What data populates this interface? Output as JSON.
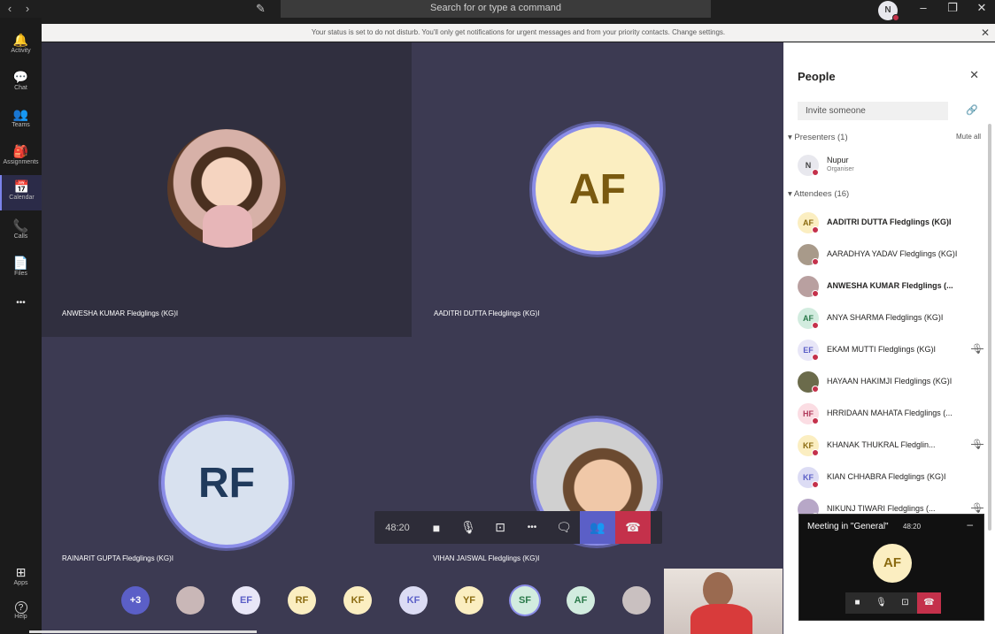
{
  "titlebar": {
    "search_placeholder": "Search for or type a command",
    "user_initial": "N",
    "back_glyph": "‹",
    "forward_glyph": "›",
    "compose_glyph": "✎",
    "minimize_glyph": "–",
    "maximize_glyph": "❐",
    "close_glyph": "✕"
  },
  "notification": {
    "text": "Your status is set to do not disturb. You'll only get notifications for urgent messages and from your priority contacts. Change settings.",
    "close_glyph": "✕"
  },
  "rail": {
    "items": [
      {
        "label": "Activity",
        "icon": "bell-icon",
        "glyph": "🔔"
      },
      {
        "label": "Chat",
        "icon": "chat-icon",
        "glyph": "💬"
      },
      {
        "label": "Teams",
        "icon": "teams-icon",
        "glyph": "👥"
      },
      {
        "label": "Assignments",
        "icon": "assignments-icon",
        "glyph": "🎒"
      },
      {
        "label": "Calendar",
        "icon": "calendar-icon",
        "glyph": "📅"
      },
      {
        "label": "Calls",
        "icon": "phone-icon",
        "glyph": "📞"
      },
      {
        "label": "Files",
        "icon": "file-icon",
        "glyph": "📄"
      },
      {
        "label": "",
        "icon": "more-icon",
        "glyph": "•••"
      }
    ],
    "apps_label": "Apps",
    "help_label": "Help",
    "apps_glyph": "⊞",
    "help_glyph": "?"
  },
  "stage": {
    "tiles": [
      {
        "name": "ANWESHA KUMAR Fledglings (KG)I",
        "initials": "",
        "photo": true
      },
      {
        "name": "AADITRI DUTTA Fledglings (KG)I",
        "initials": "AF",
        "photo": false
      },
      {
        "name": "RAINARIT GUPTA Fledglings (KG)I",
        "initials": "RF",
        "photo": false
      },
      {
        "name": "VIHAN JAISWAL Fledglings (KG)I",
        "initials": "",
        "photo": true
      }
    ],
    "controls": {
      "timer": "48:20",
      "video_glyph": "■",
      "mic_glyph": "🎙",
      "share_glyph": "⊡",
      "more_glyph": "•••",
      "chat_glyph": "🗨",
      "people_glyph": "👥",
      "hangup_glyph": "☎"
    },
    "strip": [
      {
        "label": "+3",
        "bg": "#5b5fc7",
        "fg": "#ffffff"
      },
      {
        "label": "",
        "bg": "#c9b7b7",
        "fg": "#333333"
      },
      {
        "label": "EF",
        "bg": "#e8e6f7",
        "fg": "#5b5fc7"
      },
      {
        "label": "RF",
        "bg": "#fbeec1",
        "fg": "#8a6a10"
      },
      {
        "label": "KF",
        "bg": "#fbeec1",
        "fg": "#8a6a10"
      },
      {
        "label": "KF",
        "bg": "#dcdcf4",
        "fg": "#5b5fc7"
      },
      {
        "label": "YF",
        "bg": "#fbeec1",
        "fg": "#8a6a10"
      },
      {
        "label": "SF",
        "bg": "#d2ecdf",
        "fg": "#2b7a4b"
      },
      {
        "label": "AF",
        "bg": "#d2ecdf",
        "fg": "#2b7a4b"
      },
      {
        "label": "",
        "bg": "#c9c0c0",
        "fg": "#333333"
      }
    ]
  },
  "panel": {
    "title": "People",
    "close_glyph": "✕",
    "invite_placeholder": "Invite someone",
    "share_link_glyph": "🔗",
    "presenters_header": "Presenters (1)",
    "mute_all": "Mute all",
    "presenter": {
      "name": "Nupur",
      "role": "Organiser",
      "initials": "N"
    },
    "attendees_header": "Attendees (16)",
    "attendees": [
      {
        "name": "AADITRI DUTTA Fledglings (KG)I",
        "initials": "AF",
        "bg": "#fbeec1",
        "fg": "#8a6a10",
        "bold": true,
        "muted": false
      },
      {
        "name": "AARADHYA YADAV Fledglings (KG)I",
        "initials": "",
        "bg": "#a89a8a",
        "fg": "#333333",
        "bold": false,
        "muted": false
      },
      {
        "name": "ANWESHA KUMAR Fledglings (...",
        "initials": "",
        "bg": "#b9a0a0",
        "fg": "#333333",
        "bold": true,
        "muted": false
      },
      {
        "name": "ANYA SHARMA Fledglings (KG)I",
        "initials": "AF",
        "bg": "#d2ecdf",
        "fg": "#2b7a4b",
        "bold": false,
        "muted": false
      },
      {
        "name": "EKAM MUTTI Fledglings (KG)I",
        "initials": "EF",
        "bg": "#e8e6f7",
        "fg": "#5b5fc7",
        "bold": false,
        "muted": true
      },
      {
        "name": "HAYAAN HAKIMJI Fledglings (KG)I",
        "initials": "",
        "bg": "#6b6b4b",
        "fg": "#ffffff",
        "bold": false,
        "muted": false
      },
      {
        "name": "HRRIDAAN MAHATA Fledglings (...",
        "initials": "HF",
        "bg": "#fbdde3",
        "fg": "#b03a5b",
        "bold": false,
        "muted": false
      },
      {
        "name": "KHANAK THUKRAL Fledglin...",
        "initials": "KF",
        "bg": "#fbeec1",
        "fg": "#8a6a10",
        "bold": false,
        "muted": true
      },
      {
        "name": "KIAN CHHABRA Fledglings (KG)I",
        "initials": "KF",
        "bg": "#dcdcf4",
        "fg": "#5b5fc7",
        "bold": false,
        "muted": false
      },
      {
        "name": "NIKUNJ TIWARI Fledglings (...",
        "initials": "",
        "bg": "#b7a7c7",
        "fg": "#333333",
        "bold": false,
        "muted": true
      }
    ]
  },
  "mini_window": {
    "title": "Meeting in \"General\"",
    "time": "48:20",
    "initials": "AF",
    "minimize_glyph": "–",
    "video_glyph": "■",
    "mic_glyph": "🎙",
    "share_glyph": "⊡",
    "hangup_glyph": "☎"
  }
}
